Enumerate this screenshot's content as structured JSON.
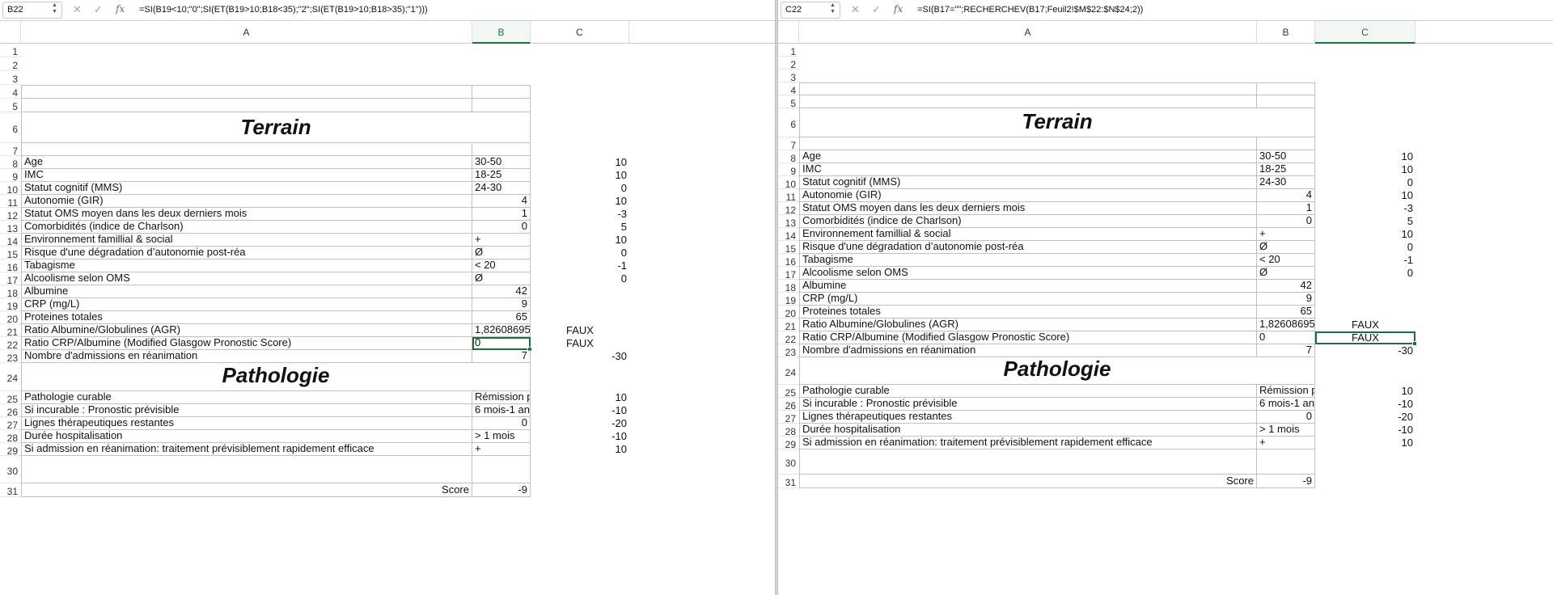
{
  "left": {
    "name_box": "B22",
    "formula": "=SI(B19<10;\"0\";SI(ET(B19>10;B18<35);\"2\";SI(ET(B19>10;B18>35);\"1\")))",
    "columns": [
      "A",
      "B",
      "C"
    ],
    "selected_column": "B"
  },
  "right": {
    "name_box": "C22",
    "formula": "=SI(B17=\"\";RECHERCHEV(B17;Feuil2!$M$22:$N$24;2))",
    "columns": [
      "A",
      "B",
      "C"
    ],
    "selected_column": "C"
  },
  "icons": {
    "cancel": "close-icon",
    "confirm": "check-icon",
    "function": "fx-icon"
  },
  "fx_label": "fx",
  "rows": [
    {
      "n": "1",
      "a": "",
      "b": "",
      "c": ""
    },
    {
      "n": "2",
      "a": "",
      "b": "",
      "c": ""
    },
    {
      "n": "3",
      "a": "",
      "b": "",
      "c": ""
    },
    {
      "n": "4",
      "a": "",
      "b": "",
      "c": ""
    },
    {
      "n": "5",
      "a": "",
      "b": "",
      "c": ""
    },
    {
      "n": "6",
      "a": "Terrain",
      "b": "",
      "c": ""
    },
    {
      "n": "7",
      "a": "",
      "b": "",
      "c": ""
    },
    {
      "n": "8",
      "a": "Age",
      "b": "30-50",
      "c": "10"
    },
    {
      "n": "9",
      "a": "IMC",
      "b": "18-25",
      "c": "10"
    },
    {
      "n": "10",
      "a": "Statut cognitif (MMS)",
      "b": "24-30",
      "c": "0"
    },
    {
      "n": "11",
      "a": "Autonomie (GIR)",
      "b": "4",
      "c": "10"
    },
    {
      "n": "12",
      "a": "Statut OMS moyen dans les deux derniers mois",
      "b": "1",
      "c": "-3"
    },
    {
      "n": "13",
      "a": "Comorbidités (indice de Charlson)",
      "b": "0",
      "c": "5"
    },
    {
      "n": "14",
      "a": "Environnement famillial & social",
      "b": "+",
      "c": "10"
    },
    {
      "n": "15",
      "a": "Risque d'une dégradation d’autonomie post-réa",
      "b": "Ø",
      "c": "0"
    },
    {
      "n": "16",
      "a": "Tabagisme",
      "b": "< 20",
      "c": "-1"
    },
    {
      "n": "17",
      "a": "Alcoolisme selon OMS",
      "b": "Ø",
      "c": "0"
    },
    {
      "n": "18",
      "a": "Albumine",
      "b": "42",
      "c": ""
    },
    {
      "n": "19",
      "a": "CRP (mg/L)",
      "b": "9",
      "c": ""
    },
    {
      "n": "20",
      "a": "Proteines totales",
      "b": "65",
      "c": ""
    },
    {
      "n": "21",
      "a": "Ratio Albumine/Globulines (AGR)",
      "b": "1,826086957",
      "c": "FAUX"
    },
    {
      "n": "22",
      "a": "Ratio CRP/Albumine (Modified Glasgow Pronostic Score)",
      "b": "0",
      "c": "FAUX"
    },
    {
      "n": "23",
      "a": "Nombre d'admissions en réanimation",
      "b": "7",
      "c": "-30"
    },
    {
      "n": "24",
      "a": "Pathologie",
      "b": "",
      "c": ""
    },
    {
      "n": "25",
      "a": "Pathologie curable",
      "b": "Rémission pro",
      "c": "10"
    },
    {
      "n": "26",
      "a": "Si incurable : Pronostic prévisible",
      "b": "6 mois-1 an",
      "c": "-10"
    },
    {
      "n": "27",
      "a": "Lignes thérapeutiques restantes",
      "b": "0",
      "c": "-20"
    },
    {
      "n": "28",
      "a": "Durée hospitalisation",
      "b": "> 1 mois",
      "c": "-10"
    },
    {
      "n": "29",
      "a": "Si admission en réanimation: traitement prévisiblement  rapidement efficace",
      "b": "+",
      "c": "10"
    },
    {
      "n": "30",
      "a": "",
      "b": "",
      "c": ""
    },
    {
      "n": "31",
      "a": "Score",
      "b": "-9",
      "c": ""
    }
  ]
}
